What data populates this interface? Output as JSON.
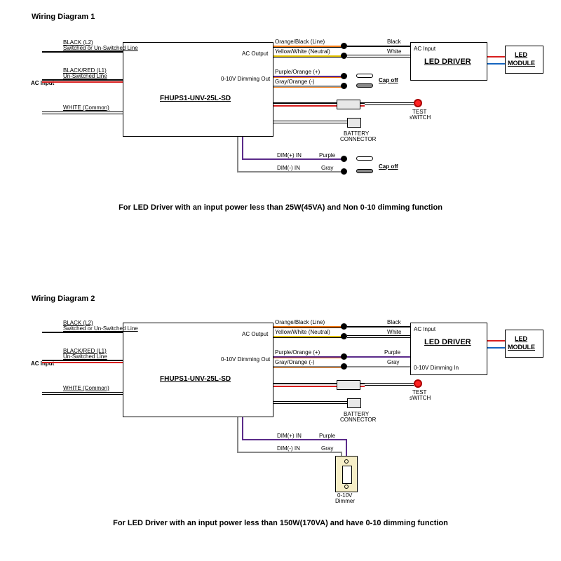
{
  "titles": {
    "d1": "Wiring Diagram 1",
    "d2": "Wiring Diagram 2"
  },
  "captions": {
    "d1": "For LED Driver with an input power less than 25W(45VA) and Non 0-10 dimming function",
    "d2": "For LED Driver with an input power less than 150W(170VA) and have 0-10 dimming function"
  },
  "main_label": "FHUPS1-UNV-25L-SD",
  "main": {
    "ac_out": "AC Output",
    "dim_out": "0-10V Dimming Out"
  },
  "driver": {
    "ac_in": "AC Input",
    "title_u": "LED DRIVER",
    "dim_in": "0-10V Dimming In"
  },
  "module": {
    "title_u": "LED MODULE"
  },
  "inputs": {
    "l2": "BLACK (L2)",
    "l2b": "Switched or Un-Switched Line",
    "l1": "BLACK/RED (L1)",
    "l1b": "Un-Switched Line",
    "ac": "AC Input",
    "n": "WHITE (Common)"
  },
  "outwires": {
    "line": "Orange/Black (Line)",
    "neutral": "Yellow/White (Neutral)",
    "pplus": "Purple/Orange (+)",
    "gminus": "Gray/Orange (-)",
    "black": "Black",
    "white": "White",
    "purple": "Purple",
    "gray": "Gray",
    "capoff": "Cap off"
  },
  "dim": {
    "plus": "DIM(+) IN",
    "minus": "DIM(-) IN"
  },
  "comp": {
    "test": "TEST sWITCH",
    "batt": "BATTERY CONNECTOR",
    "dimmer": "0-10V Dimmer"
  },
  "colors": {
    "black": "#000",
    "white": "#000",
    "orange": "#f07810",
    "red": "#d81e1e",
    "gray": "#888",
    "purple": "#5b2b8a",
    "yellow": "#e3c200"
  }
}
